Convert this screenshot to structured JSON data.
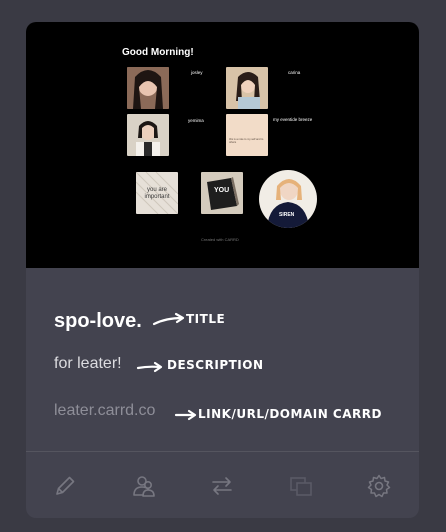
{
  "preview": {
    "greeting": "Good Morning!",
    "names": [
      "josley",
      "carina",
      "yemima",
      "my eventide breeze"
    ],
    "note_card": "this is a note to my self and to others",
    "sticker_text": "you are important",
    "book_text": "YOU",
    "circle_text": "SIREN",
    "footer": "Created with CARRD"
  },
  "site": {
    "title": "spo-love.",
    "description": "for leater!",
    "url": "leater.carrd.co"
  },
  "annotations": {
    "title": "TITLE",
    "description": "DESCRIPTION",
    "url": "LINK/URL/DOMAIN CARRD"
  },
  "toolbar": {
    "items": [
      {
        "icon": "pencil-icon",
        "action": "edit"
      },
      {
        "icon": "users-icon",
        "action": "share"
      },
      {
        "icon": "swap-icon",
        "action": "transfer"
      },
      {
        "icon": "duplicate-icon",
        "action": "duplicate"
      },
      {
        "icon": "gear-icon",
        "action": "settings"
      }
    ]
  },
  "colors": {
    "background": "#3a3a44",
    "card": "#43434f",
    "preview_bg": "#000000",
    "icon": "#777781"
  }
}
